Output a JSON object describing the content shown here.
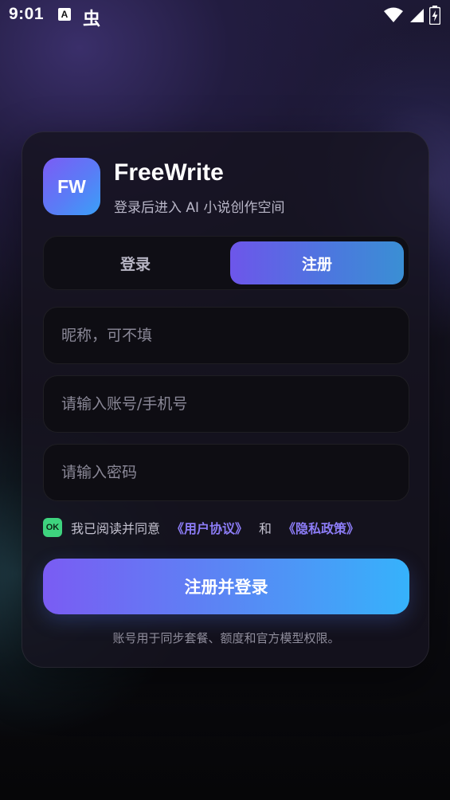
{
  "status_bar": {
    "time": "9:01",
    "a_badge": "A",
    "bug_glyph": "虫"
  },
  "app": {
    "logo_text": "FW",
    "title": "FreeWrite",
    "subtitle": "登录后进入 AI 小说创作空间"
  },
  "tabs": {
    "login": "登录",
    "register": "注册",
    "active": "register"
  },
  "form": {
    "nickname_placeholder": "昵称，可不填",
    "account_placeholder": "请输入账号/手机号",
    "password_placeholder": "请输入密码",
    "nickname_value": "",
    "account_value": "",
    "password_value": ""
  },
  "agreement": {
    "checkbox_text": "OK",
    "prefix": "我已阅读并同意",
    "user_agreement": "《用户协议》",
    "and": "和",
    "privacy_policy": "《隐私政策》"
  },
  "submit_label": "注册并登录",
  "footnote": "账号用于同步套餐、额度和官方模型权限。",
  "colors": {
    "accent_start": "#7a5cf3",
    "accent_end": "#36b2fb",
    "link": "#8c7cf6",
    "check_green": "#3ed37e"
  }
}
